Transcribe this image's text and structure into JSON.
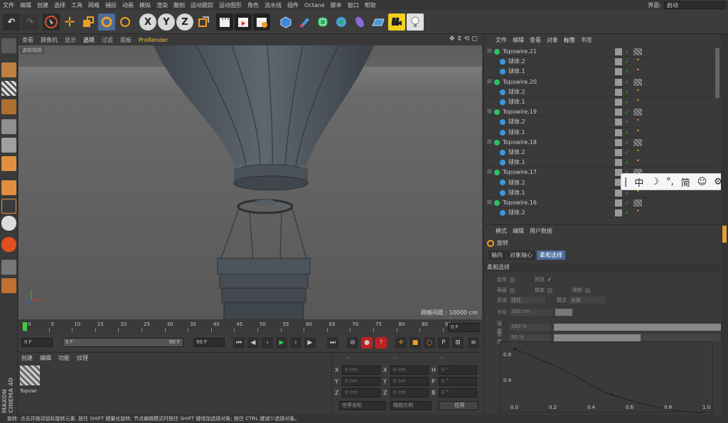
{
  "menubar": {
    "items": [
      "文件",
      "编辑",
      "创建",
      "选择",
      "工具",
      "网格",
      "捕捉",
      "动画",
      "模拟",
      "渲染",
      "雕刻",
      "运动跟踪",
      "运动图形",
      "角色",
      "流水线",
      "插件",
      "Octane",
      "脚本",
      "窗口",
      "帮助"
    ],
    "layout_label": "界面:",
    "layout_value": "启动"
  },
  "toolbar": {
    "axis_x": "X",
    "axis_y": "Y",
    "axis_z": "Z"
  },
  "viewport": {
    "menu": [
      "查看",
      "摄像机",
      "显示",
      "选项",
      "过滤",
      "面板",
      "ProRender"
    ],
    "label": "透视视图",
    "grid_readout": "网格间距 : 10000 cm"
  },
  "timeline": {
    "ticks": [
      "0",
      "5",
      "10",
      "15",
      "20",
      "25",
      "30",
      "35",
      "40",
      "45",
      "50",
      "55",
      "60",
      "65",
      "70",
      "75",
      "80",
      "85",
      "90"
    ],
    "current_frame": "0 F"
  },
  "playbar": {
    "start": "0 F",
    "slider_start": "0 F",
    "slider_end": "90 F",
    "end": "90 F"
  },
  "materials": {
    "menu": [
      "创建",
      "编辑",
      "功能",
      "纹理"
    ],
    "item_label": "Topowi"
  },
  "coords": {
    "header": [
      "--",
      "--",
      "--"
    ],
    "rows": [
      {
        "a": "X",
        "av": "0 cm",
        "b": "X",
        "bv": "0 cm",
        "c": "H",
        "cv": "0 °"
      },
      {
        "a": "Y",
        "av": "0 cm",
        "b": "Y",
        "bv": "0 cm",
        "c": "P",
        "cv": "0 °"
      },
      {
        "a": "Z",
        "av": "0 cm",
        "b": "Z",
        "bv": "0 cm",
        "c": "B",
        "cv": "0 °"
      }
    ],
    "mode1": "世界坐标",
    "mode2": "缩放比例",
    "apply": "应用"
  },
  "objects": {
    "menu": [
      "文件",
      "编辑",
      "查看",
      "对象",
      "标签",
      "书签"
    ],
    "items": [
      {
        "name": "Topowire.21",
        "child": false
      },
      {
        "name": "球体.2",
        "child": true
      },
      {
        "name": "球体.1",
        "child": true
      },
      {
        "name": "Topowire.20",
        "child": false
      },
      {
        "name": "球体.2",
        "child": true
      },
      {
        "name": "球体.1",
        "child": true
      },
      {
        "name": "Topowire.19",
        "child": false
      },
      {
        "name": "球体.2",
        "child": true
      },
      {
        "name": "球体.1",
        "child": true
      },
      {
        "name": "Topowire.18",
        "child": false
      },
      {
        "name": "球体.2",
        "child": true
      },
      {
        "name": "球体.1",
        "child": true
      },
      {
        "name": "Topowire.17",
        "child": false
      },
      {
        "name": "球体.2",
        "child": true
      },
      {
        "name": "球体.1",
        "child": true
      },
      {
        "name": "Topowire.16",
        "child": false
      },
      {
        "name": "球体.2",
        "child": true
      }
    ]
  },
  "attributes": {
    "menu": [
      "模式",
      "编辑",
      "用户数据"
    ],
    "title": "旋转",
    "tabs": [
      "轴向",
      "对象轴心",
      "柔和选择"
    ],
    "section": "柔和选择",
    "enable": "启用",
    "preview": "预览",
    "surface": "表面",
    "rubber": "橡皮",
    "restrict": "限制",
    "falloff_label": "衰减",
    "falloff_value": "线性",
    "mode_label": "模式",
    "mode_value": "全部",
    "radius_label": "半径",
    "radius_value": "100 cm",
    "strength_label": "强度",
    "strength_value": "100 %",
    "width_label": "宽度",
    "width_value": "50 %",
    "strength_fill": 1.0,
    "width_fill": 0.5,
    "graph_x": [
      "0.0",
      "0.2",
      "0.4",
      "0.6",
      "0.8",
      "1.0"
    ],
    "graph_y": [
      "0.8",
      "0.4"
    ]
  },
  "status": {
    "text": "旋转: 点击并拖动鼠标旋转元素. 按住 SHIFT 键量化旋转; 节点编辑模式时按住 SHIFT 键增加选择对象; 按住 CTRL 键减少选择对象。"
  },
  "ime": {
    "items": [
      "中",
      "°,",
      "简"
    ]
  },
  "brand": "MAXON CINEMA 4D"
}
